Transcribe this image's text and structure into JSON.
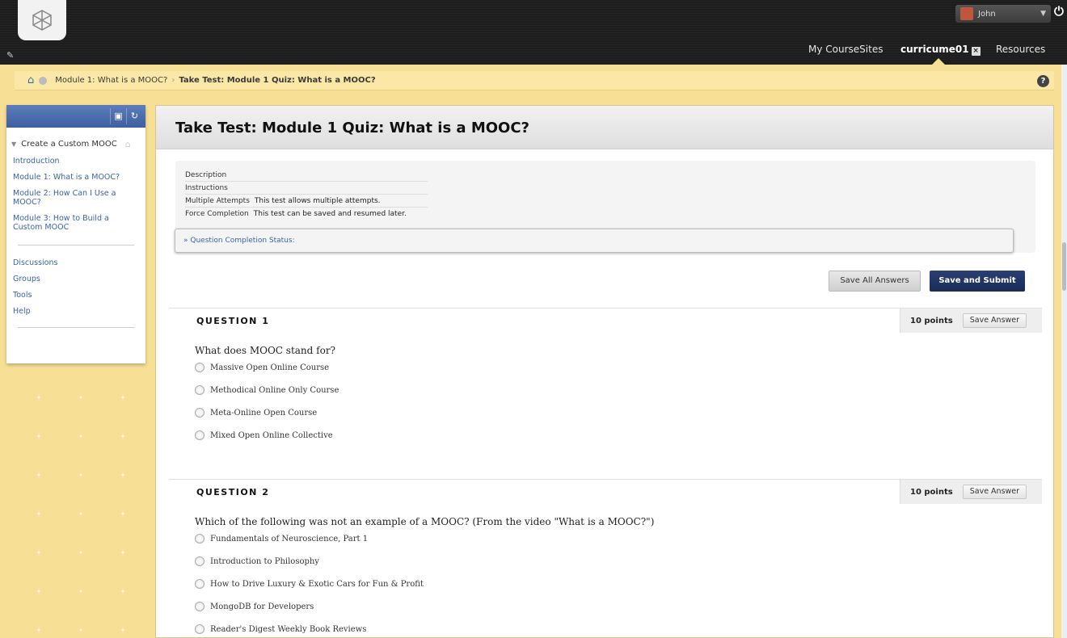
{
  "header": {
    "user_name": "John",
    "nav": [
      "My CourseSites",
      "curricume01",
      "Resources"
    ]
  },
  "breadcrumb": {
    "parent": "Module 1: What is a MOOC?",
    "current": "Take Test: Module 1 Quiz: What is a MOOC?"
  },
  "sidebar": {
    "course_title": "Create a Custom MOOC",
    "modules": [
      "Introduction",
      "Module 1: What is a MOOC?",
      "Module 2: How Can I Use a MOOC?",
      "Module 3: How to Build a Custom MOOC"
    ],
    "tools": [
      "Discussions",
      "Groups",
      "Tools",
      "Help"
    ]
  },
  "main": {
    "title": "Take Test: Module 1 Quiz: What is a MOOC?",
    "info": [
      {
        "label": "Description",
        "value": ""
      },
      {
        "label": "Instructions",
        "value": ""
      },
      {
        "label": "Multiple Attempts",
        "value": "This test allows multiple attempts."
      },
      {
        "label": "Force Completion",
        "value": "This test can be saved and resumed later."
      }
    ],
    "completion_status": "Question Completion Status:",
    "save_all_label": "Save All Answers",
    "save_submit_label": "Save and Submit"
  },
  "questions": [
    {
      "label": "QUESTION 1",
      "points": "10 points",
      "save_label": "Save Answer",
      "text": "What does MOOC stand for?",
      "options": [
        "Massive Open Online Course",
        "Methodical Online Only Course",
        "Meta-Online Open Course",
        "Mixed Open Online Collective"
      ]
    },
    {
      "label": "QUESTION 2",
      "points": "10 points",
      "save_label": "Save Answer",
      "text": "Which of the following was not an example of a MOOC? (From the video \"What is a MOOC?\")",
      "options": [
        "Fundamentals of Neuroscience, Part 1",
        "Introduction to Philosophy",
        "How to Drive Luxury & Exotic Cars for Fun & Profit",
        "MongoDB for Developers",
        "Reader's Digest Weekly Book Reviews"
      ]
    }
  ]
}
